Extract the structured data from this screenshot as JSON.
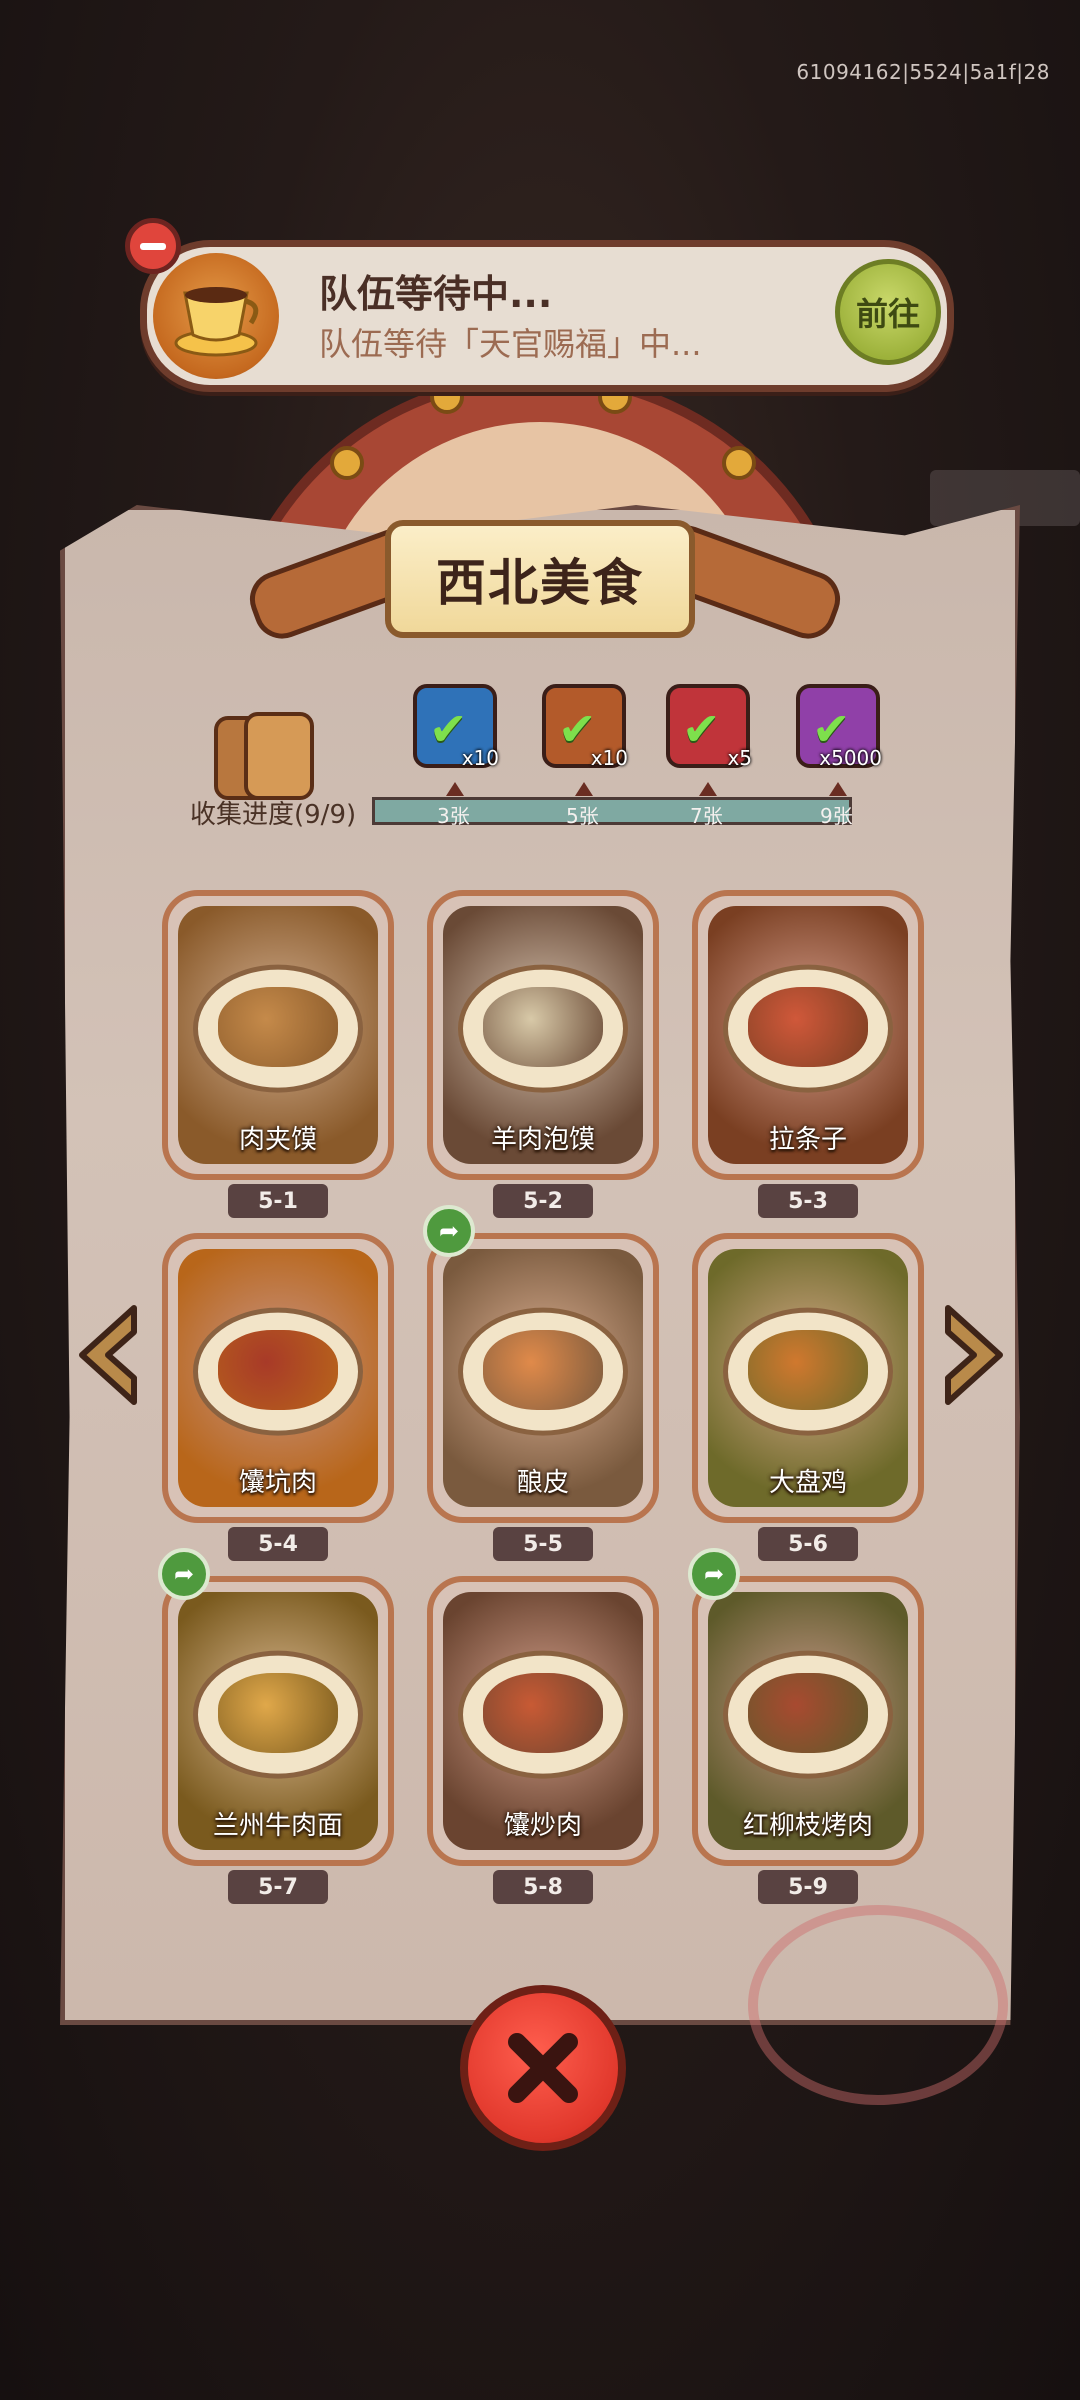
{
  "session_id": "61094162|5524|5a1f|28",
  "team_banner": {
    "title": "队伍等待中...",
    "subtitle": "队伍等待「天官赐福」中...",
    "goto_label": "前往"
  },
  "collection": {
    "title": "西北美食",
    "progress_label": "收集进度(9/9)",
    "progress": {
      "collected": 9,
      "total": 9
    },
    "milestones": [
      {
        "label": "3张",
        "reward_icon": "treasure-chest-icon",
        "count": "x10",
        "color": "#2f72b8"
      },
      {
        "label": "5张",
        "reward_icon": "scroll-key-icon",
        "count": "x10",
        "color": "#b35a2a"
      },
      {
        "label": "7张",
        "reward_icon": "purple-orb-icon",
        "count": "x5",
        "color": "#c0343a"
      },
      {
        "label": "9张",
        "reward_icon": "silver-gem-icon",
        "count": "x5000",
        "color": "#9040a8"
      }
    ]
  },
  "cards": [
    {
      "name": "肉夹馍",
      "code": "5-1",
      "shared": false,
      "bg": "#8a5a2a",
      "food": "#c58a4a"
    },
    {
      "name": "羊肉泡馍",
      "code": "5-2",
      "shared": false,
      "bg": "#6a4a36",
      "food": "#d8c9a8"
    },
    {
      "name": "拉条子",
      "code": "5-3",
      "shared": false,
      "bg": "#7a3f22",
      "food": "#d0583a"
    },
    {
      "name": "馕坑肉",
      "code": "5-4",
      "shared": false,
      "bg": "#b8661a",
      "food": "#a83a28"
    },
    {
      "name": "酿皮",
      "code": "5-5",
      "shared": true,
      "bg": "#7a5a3e",
      "food": "#e08a4a"
    },
    {
      "name": "大盘鸡",
      "code": "5-6",
      "shared": false,
      "bg": "#6e6a2a",
      "food": "#d0782e"
    },
    {
      "name": "兰州牛肉面",
      "code": "5-7",
      "shared": true,
      "bg": "#7a5a1e",
      "food": "#e0a84a"
    },
    {
      "name": "馕炒肉",
      "code": "5-8",
      "shared": false,
      "bg": "#6a4430",
      "food": "#c85a34"
    },
    {
      "name": "红柳枝烤肉",
      "code": "5-9",
      "shared": true,
      "bg": "#5e5a2a",
      "food": "#a84a30"
    }
  ],
  "icons": {
    "prev": "left-arrow-icon",
    "next": "right-arrow-icon",
    "close": "close-x-icon",
    "share": "share-arrow-icon",
    "team": "coffee-cup-icon",
    "collapse": "minus-icon"
  },
  "colors": {
    "accent_red": "#e1382c",
    "progress": "#7fa9a2",
    "card_border": "#b9754f"
  }
}
